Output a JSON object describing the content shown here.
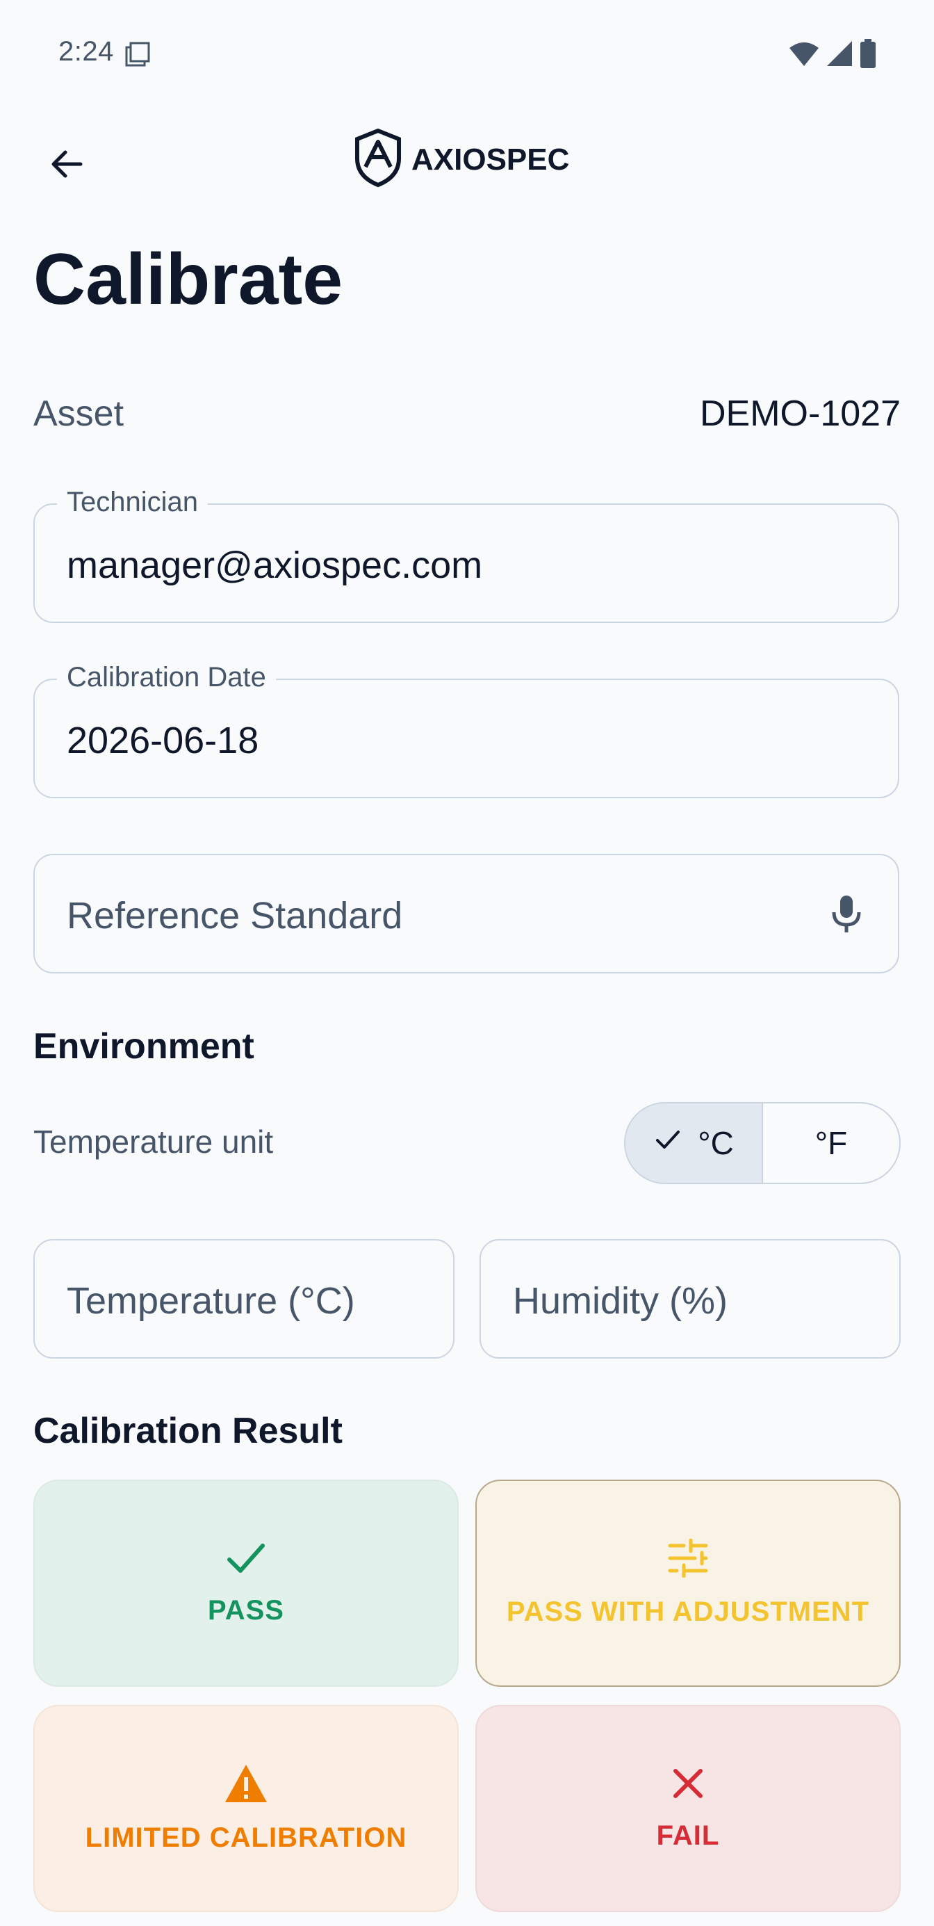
{
  "status_bar": {
    "time": "2:24"
  },
  "header": {
    "logo_text": "AXIOSPEC"
  },
  "page": {
    "title": "Calibrate"
  },
  "asset": {
    "label": "Asset",
    "value": "DEMO-1027"
  },
  "fields": {
    "technician": {
      "label": "Technician",
      "value": "manager@axiospec.com"
    },
    "calibration_date": {
      "label": "Calibration Date",
      "value": "2026-06-18"
    },
    "reference_standard": {
      "placeholder": "Reference Standard"
    }
  },
  "environment": {
    "heading": "Environment",
    "unit_label": "Temperature unit",
    "unit_options": [
      {
        "label": "°C",
        "selected": true
      },
      {
        "label": "°F",
        "selected": false
      }
    ],
    "temperature_placeholder": "Temperature (°C)",
    "humidity_placeholder": "Humidity (%)"
  },
  "calibration_result": {
    "heading": "Calibration Result",
    "options": [
      {
        "label": "PASS",
        "icon": "check-icon",
        "color": "#15935f"
      },
      {
        "label": "PASS WITH ADJUSTMENT",
        "icon": "sliders-icon",
        "color": "#f4c430"
      },
      {
        "label": "LIMITED CALIBRATION",
        "icon": "warning-icon",
        "color": "#ef7d00"
      },
      {
        "label": "FAIL",
        "icon": "close-icon",
        "color": "#d62c36"
      }
    ]
  },
  "colors": {
    "background": "#f8fafc",
    "text": "#0f172a",
    "muted": "#475569",
    "border": "#cbd5e1"
  }
}
